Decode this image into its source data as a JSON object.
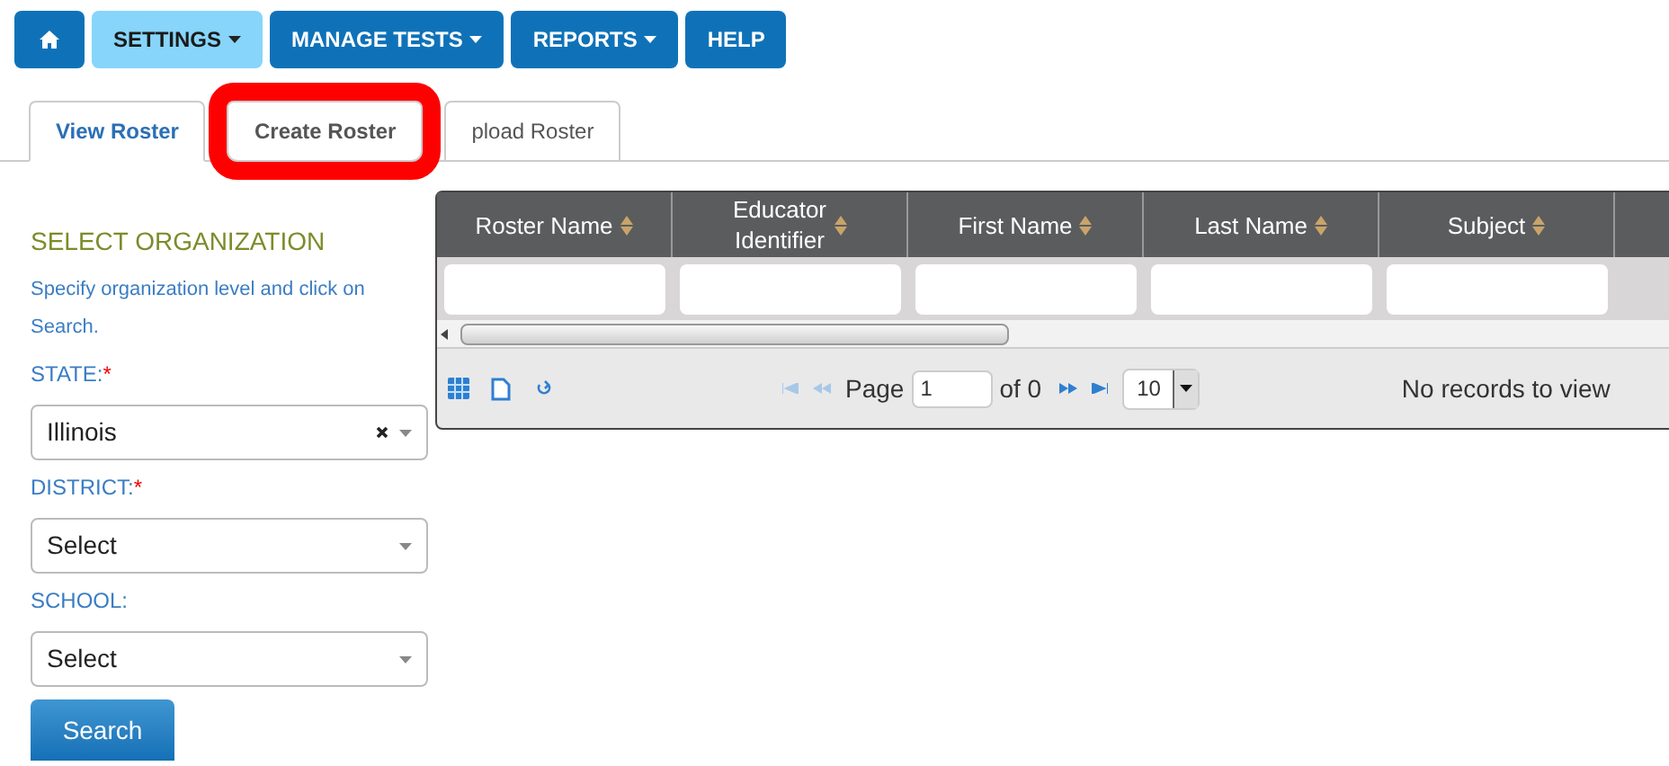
{
  "nav": [
    {
      "kind": "home",
      "selected": false
    },
    {
      "kind": "text",
      "label": "SETTINGS",
      "selected": true,
      "dropdown": true
    },
    {
      "kind": "text",
      "label": "MANAGE TESTS",
      "selected": false,
      "dropdown": true
    },
    {
      "kind": "text",
      "label": "REPORTS",
      "selected": false,
      "dropdown": true
    },
    {
      "kind": "text",
      "label": "HELP",
      "selected": false,
      "dropdown": false
    }
  ],
  "tabs": [
    {
      "label": "View Roster",
      "selected": true,
      "highlighted": false
    },
    {
      "label": "Create Roster",
      "selected": false,
      "highlighted": true
    },
    {
      "label": "pload Roster",
      "selected": false,
      "highlighted": false
    }
  ],
  "filter": {
    "title": "SELECT ORGANIZATION",
    "hint": "Specify organization level and click on Search.",
    "fields": [
      {
        "label": "STATE:",
        "required_mark": "*",
        "value": "Illinois",
        "clearable": true
      },
      {
        "label": "DISTRICT:",
        "required_mark": "*",
        "value": "Select",
        "clearable": false
      },
      {
        "label": "SCHOOL:",
        "value": "Select",
        "clearable": false
      }
    ],
    "button": "Search"
  },
  "grid": {
    "columns": [
      {
        "line1": "Roster Name"
      },
      {
        "line1": "Educator",
        "line2": "Identifier"
      },
      {
        "line1": "First Name"
      },
      {
        "line1": "Last Name"
      },
      {
        "line1": "Subject"
      }
    ],
    "pager": {
      "page_label": "Page",
      "page": "1",
      "of": "of 0",
      "page_size": "10",
      "status": "No records to view"
    }
  }
}
